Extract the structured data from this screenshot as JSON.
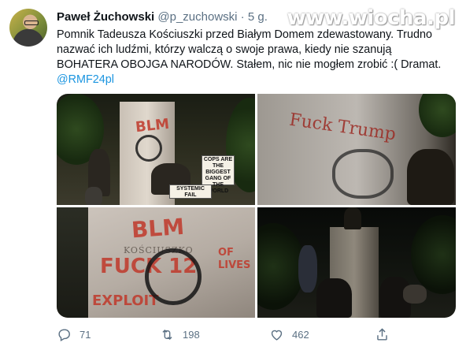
{
  "tweet": {
    "author_name": "Paweł Żuchowski",
    "handle": "@p_zuchowski",
    "separator": "·",
    "time": "5 g.",
    "text": "Pomnik Tadeusza Kościuszki przed Białym Domem zdewastowany. Trudno nazwać ich ludźmi, którzy walczą o swoje prawa, kiedy nie szanują BOHATERA OBOJGA NARODÓW. Stałem, nic nie mogłem zrobić :( Dramat.",
    "mention": "@RMF24pl"
  },
  "watermark": "www.wiocha.pl",
  "media": {
    "photo1_graffiti": "BLM",
    "photo1_sign_1": "COPS ARE THE BIGGEST GANG OF THE WORLD",
    "photo1_sign_2": "SYSTEMIC FAIL",
    "photo2_graffiti": "Fuck Trump",
    "photo3_inscription": "KOŚCIUSZKO",
    "photo3_graffiti_1": "BLM",
    "photo3_graffiti_2": "FUCK 12",
    "photo3_graffiti_3": "OF LIVES",
    "photo3_graffiti_4": "EXPLOIT"
  },
  "actions": {
    "replies": "71",
    "retweets": "198",
    "likes": "462"
  },
  "icons": {
    "reply": "reply-icon",
    "retweet": "retweet-icon",
    "like": "heart-icon",
    "share": "share-icon"
  },
  "colors": {
    "accent": "#1b95e0",
    "secondary_text": "#5b7083",
    "primary_text": "#0f1419",
    "graffiti_red": "#c0392b"
  }
}
